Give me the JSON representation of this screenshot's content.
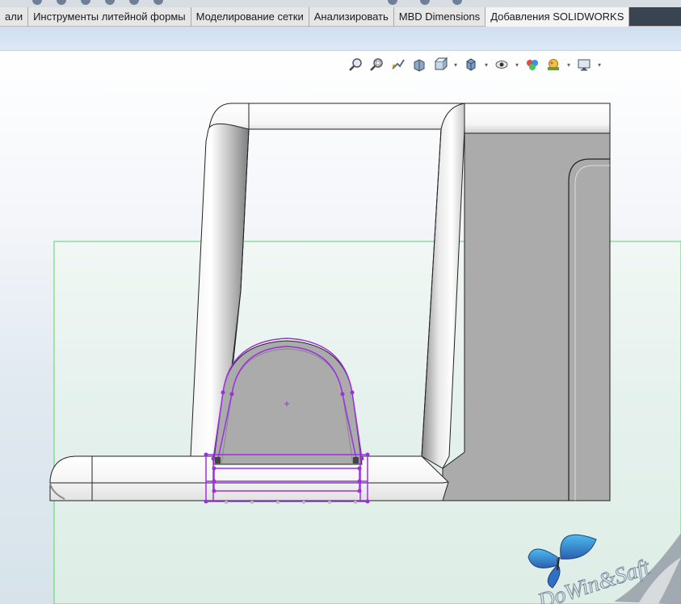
{
  "tabs": [
    {
      "label": "али"
    },
    {
      "label": "Инструменты литейной формы"
    },
    {
      "label": "Моделирование сетки"
    },
    {
      "label": "Анализировать"
    },
    {
      "label": "MBD Dimensions"
    },
    {
      "label": "Добавления SOLIDWORKS"
    }
  ],
  "view_toolbar": {
    "icons": [
      "zoom-to-fit-icon",
      "zoom-to-area-icon",
      "previous-view-icon",
      "section-view-icon",
      "view-orientation-icon",
      "display-style-icon",
      "hide-show-items-icon",
      "edit-appearance-icon",
      "apply-scene-icon",
      "view-settings-icon"
    ]
  },
  "watermark": {
    "text": "DoWin&Saft"
  },
  "colors": {
    "sketch": "#9b30e0",
    "plane": "#5bd16b",
    "part_face": "#ababab",
    "tab_bar": "#e6e6e6"
  }
}
